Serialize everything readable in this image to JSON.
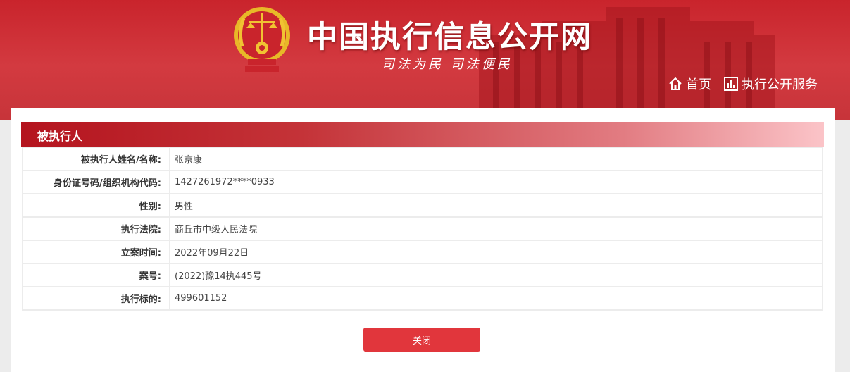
{
  "header": {
    "site_title": "中国执行信息公开网",
    "slogan": "司法为民   司法便民",
    "nav": [
      {
        "label": "首页",
        "icon": "home-icon"
      },
      {
        "label": "执行公开服务",
        "icon": "bar-chart-icon"
      }
    ],
    "colors": {
      "brand_red": "#c9242c",
      "emblem_gold": "#f1c232"
    }
  },
  "section": {
    "title": "被执行人",
    "rows": [
      {
        "label": "被执行人姓名/名称:",
        "value": "张京康"
      },
      {
        "label": "身份证号码/组织机构代码:",
        "value": "1427261972****0933"
      },
      {
        "label": "性别:",
        "value": "男性"
      },
      {
        "label": "执行法院:",
        "value": "商丘市中级人民法院"
      },
      {
        "label": "立案时间:",
        "value": "2022年09月22日"
      },
      {
        "label": "案号:",
        "value": "(2022)豫14执445号"
      },
      {
        "label": "执行标的:",
        "value": "499601152"
      }
    ]
  },
  "actions": {
    "close_label": "关闭",
    "button_color": "#e1363c"
  }
}
